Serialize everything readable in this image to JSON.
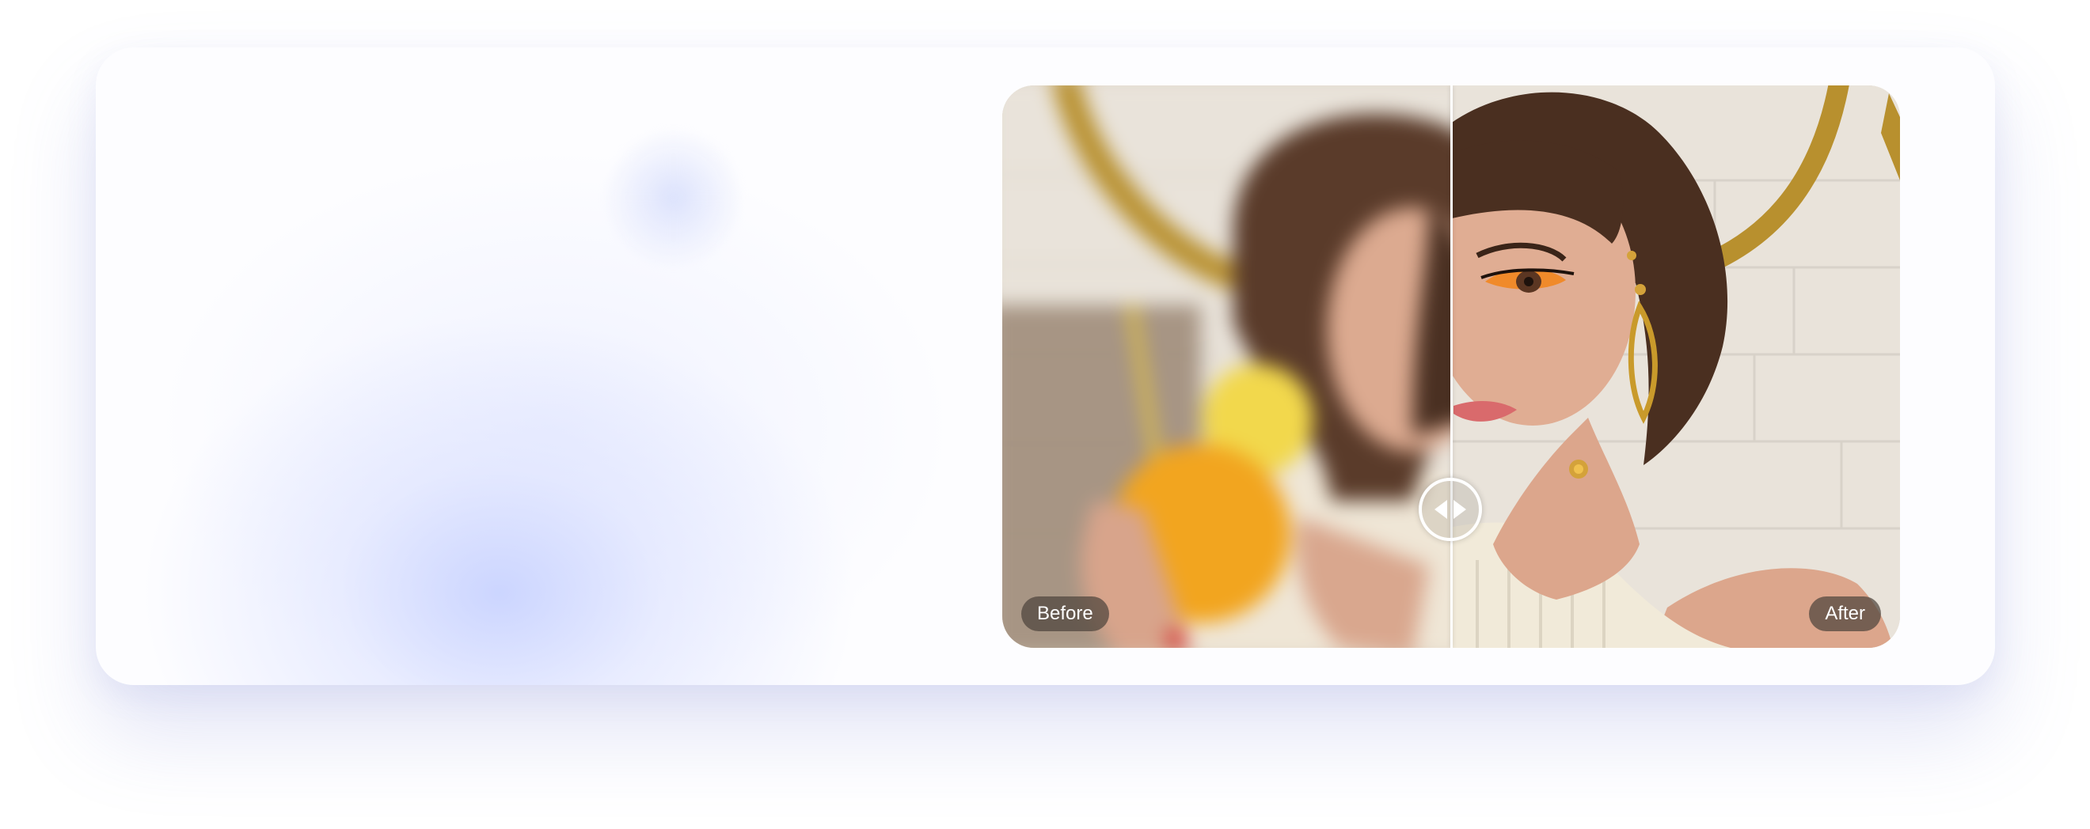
{
  "comparison": {
    "before_label": "Before",
    "after_label": "After",
    "slider_position": 0.5
  },
  "icons": {
    "slider_handle": "left-right-arrows-icon"
  },
  "colors": {
    "accent_glow": "#c4cfff",
    "badge_bg": "#4e443c",
    "handle_border": "#ffffff"
  }
}
